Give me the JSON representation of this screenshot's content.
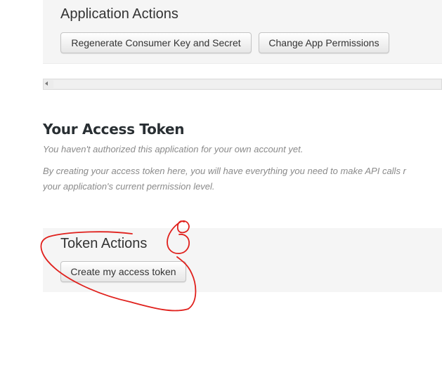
{
  "application_actions": {
    "title": "Application Actions",
    "regenerate_button": "Regenerate Consumer Key and Secret",
    "permissions_button": "Change App Permissions"
  },
  "access_token": {
    "title": "Your Access Token",
    "not_authorized_note": "You haven't authorized this application for your own account yet.",
    "create_note_line1": "By creating your access token here, you will have everything you need to make API calls r",
    "create_note_line2": "your application's current permission level."
  },
  "token_actions": {
    "title": "Token Actions",
    "create_button": "Create my access token"
  },
  "annotation": {
    "color": "#e0201c",
    "label": "6"
  }
}
